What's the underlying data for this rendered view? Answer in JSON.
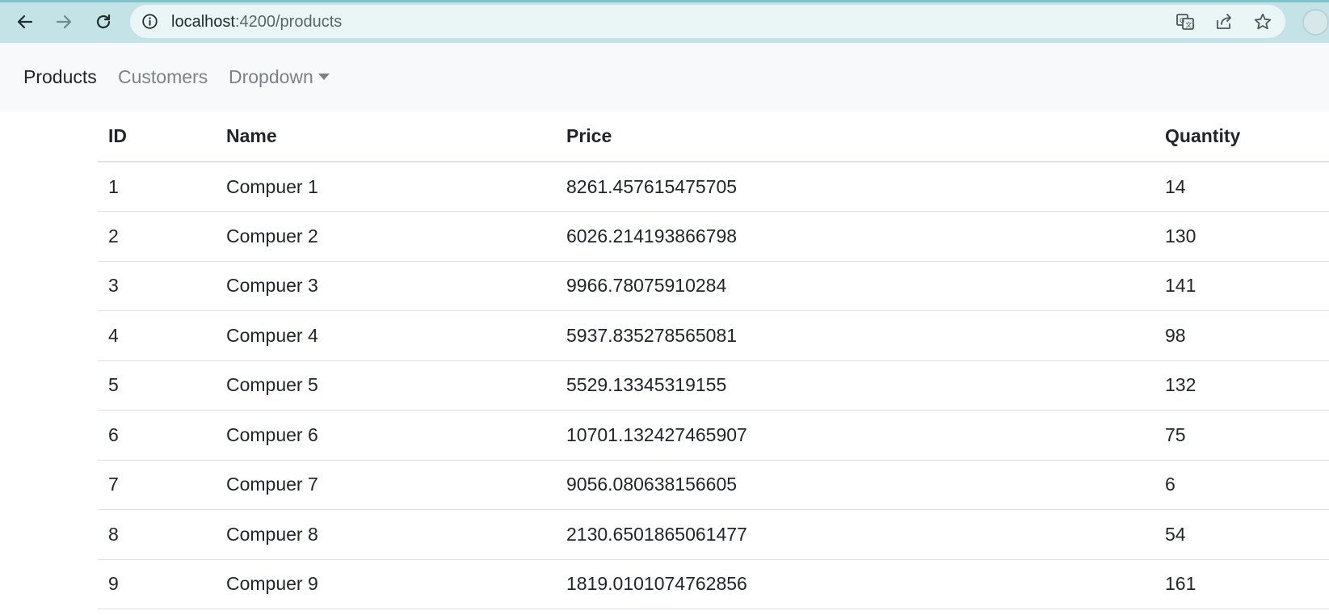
{
  "browser": {
    "url_host": "localhost",
    "url_rest": ":4200/products"
  },
  "navbar": {
    "items": [
      {
        "label": "Products",
        "active": true
      },
      {
        "label": "Customers",
        "active": false
      },
      {
        "label": "Dropdown",
        "active": false
      }
    ]
  },
  "table": {
    "headers": [
      "ID",
      "Name",
      "Price",
      "Quantity"
    ],
    "rows": [
      [
        "1",
        "Compuer 1",
        "8261.457615475705",
        "14"
      ],
      [
        "2",
        "Compuer 2",
        "6026.214193866798",
        "130"
      ],
      [
        "3",
        "Compuer 3",
        "9966.78075910284",
        "141"
      ],
      [
        "4",
        "Compuer 4",
        "5937.835278565081",
        "98"
      ],
      [
        "5",
        "Compuer 5",
        "5529.13345319155",
        "132"
      ],
      [
        "6",
        "Compuer 6",
        "10701.132427465907",
        "75"
      ],
      [
        "7",
        "Compuer 7",
        "9056.080638156605",
        "6"
      ],
      [
        "8",
        "Compuer 8",
        "2130.6501865061477",
        "54"
      ],
      [
        "9",
        "Compuer 9",
        "1819.0101074762856",
        "161"
      ]
    ]
  },
  "icons": {
    "back": "arrow-left-icon",
    "forward": "arrow-right-icon",
    "reload": "reload-icon",
    "info": "info-icon",
    "translate": "translate-icon",
    "share": "share-icon",
    "bookmark": "star-icon"
  }
}
